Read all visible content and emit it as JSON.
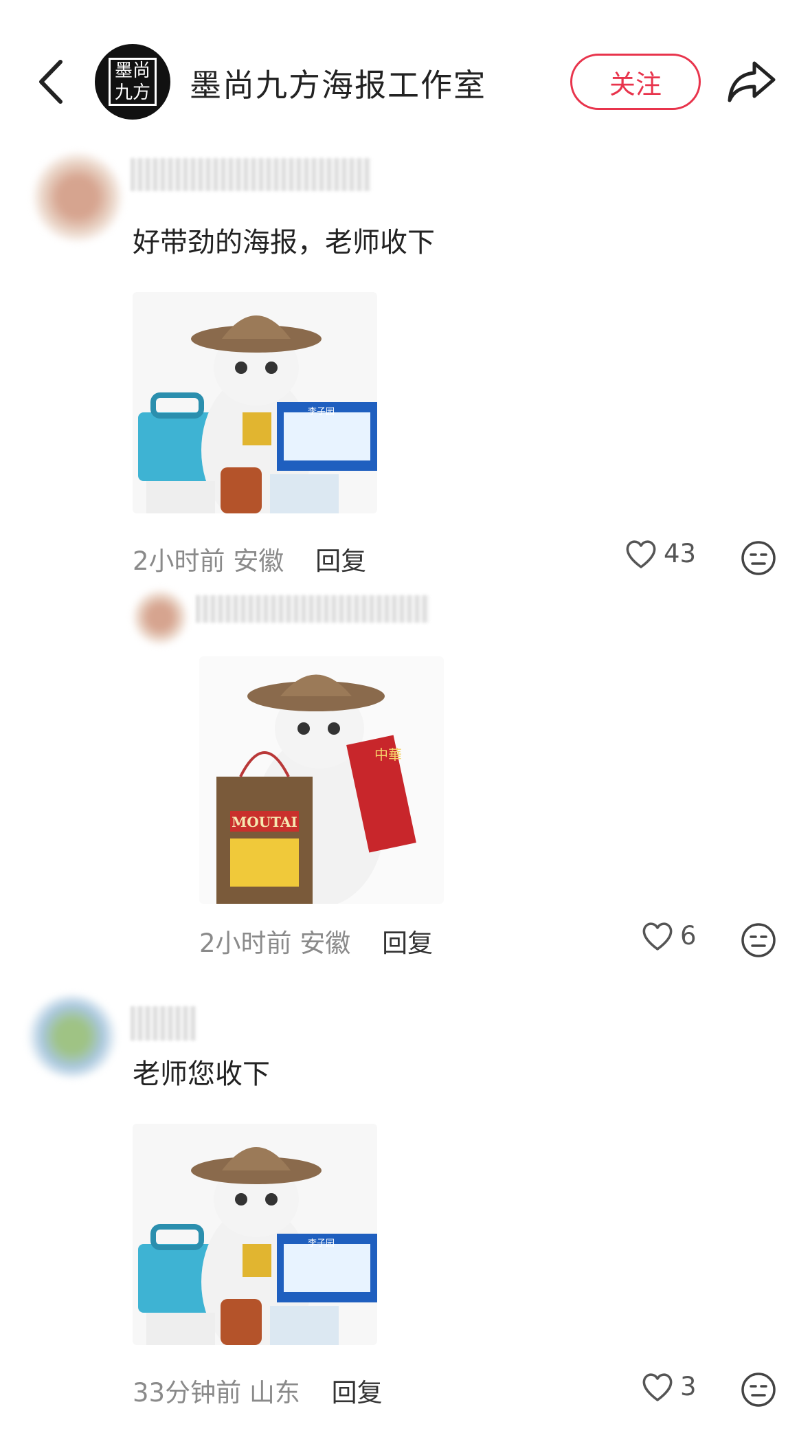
{
  "header": {
    "title": "墨尚九方海报工作室",
    "avatar_text": "墨尚九方",
    "follow_label": "关注"
  },
  "comments": [
    {
      "text": "好带劲的海报，老师收下",
      "time": "2小时前",
      "location": "安徽",
      "reply_label": "回复",
      "likes": "43"
    },
    {
      "time": "2小时前",
      "location": "安徽",
      "reply_label": "回复",
      "likes": "6"
    },
    {
      "text": "老师您收下",
      "time": "33分钟前",
      "location": "山东",
      "reply_label": "回复",
      "likes": "3"
    }
  ],
  "meme_labels": {
    "moutai_brand": "MOUTAI",
    "cigarette_brand": "中華",
    "drink_brand": "李子园"
  },
  "colors": {
    "accent": "#e8344c",
    "meta": "#8a8a8a"
  }
}
